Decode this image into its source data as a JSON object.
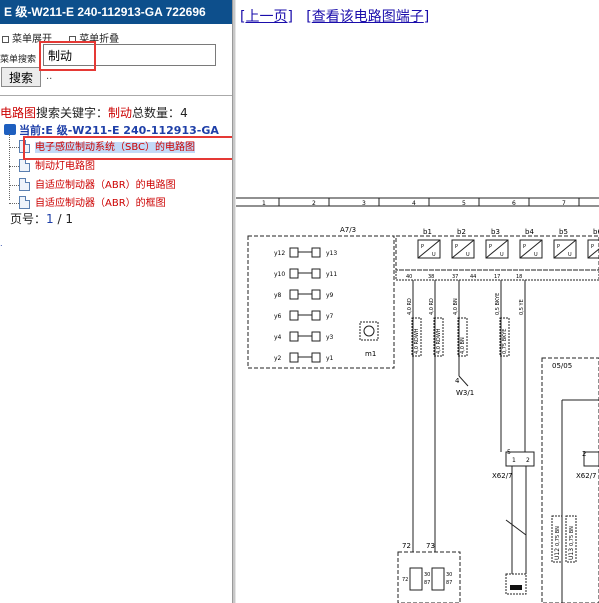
{
  "sidebar": {
    "title": "E 级-W211-E 240-112913-GA 722696",
    "menu_expand": "菜单展开",
    "menu_collapse": "菜单折叠",
    "search_label": "菜单搜索",
    "search_value": "制动",
    "search_button": "搜索",
    "dots": "..",
    "summary": {
      "prefix": "电路图",
      "middle": "搜索关键字：",
      "keyword": "制动",
      "count_label": "总数量：",
      "count": "4"
    },
    "current": "当前:E 级-W211-E 240-112913-GA",
    "items": [
      "电子感应制动系统（SBC）的电路图",
      "制动灯电路图",
      "自适应制动器（ABR）的电路图",
      "自适应制动器（ABR）的框图"
    ],
    "pager": {
      "label": "页号：",
      "current": "1",
      "separator": " / ",
      "total": "1"
    },
    "link_dot": "."
  },
  "main": {
    "nav": {
      "prev": "上一页",
      "view_terminals": "查看该电路图端子",
      "open_bracket": "[",
      "close_bracket": "]"
    }
  },
  "diagram": {
    "ruler_numbers": [
      "1",
      "2",
      "3",
      "4",
      "5",
      "6",
      "7",
      "8"
    ],
    "module_label": "A7/3",
    "valve_left": [
      "y12",
      "y10",
      "y8",
      "y6",
      "y4",
      "y2"
    ],
    "valve_right": [
      "y13",
      "y11",
      "y9",
      "y7",
      "y3",
      "y1"
    ],
    "motor_label": "m1",
    "sensors": [
      "b1",
      "b2",
      "b3",
      "b4",
      "b5",
      "b6"
    ],
    "sensor_pu": [
      "P",
      "U"
    ],
    "pins": [
      "40",
      "38",
      "37",
      "44",
      "17",
      "18"
    ],
    "wires": [
      "4,0 RD",
      "4,0 RD",
      "4,0 BN",
      "0,5 BKYE",
      "0,5 YE"
    ],
    "wire_under": [
      "4,0 RDWH",
      "4,0 RDWH",
      "4,0 BN",
      "0,75 BKYE"
    ],
    "ground": "W3/1",
    "ground_num": "4",
    "connector_left": "X62/7",
    "connector_left_pins": [
      "1",
      "2"
    ],
    "connector_left_top": "5",
    "connector_right": "X62/7",
    "connector_right_num": "2",
    "box_label": "05/05",
    "relay_labels": [
      "72",
      "73"
    ],
    "relay_pins": [
      "30",
      "87",
      "30",
      "87"
    ],
    "bottom_wires": [
      "0,75 BN",
      "0,75 BN"
    ],
    "bottom_nums": [
      "U12",
      "U13"
    ]
  }
}
